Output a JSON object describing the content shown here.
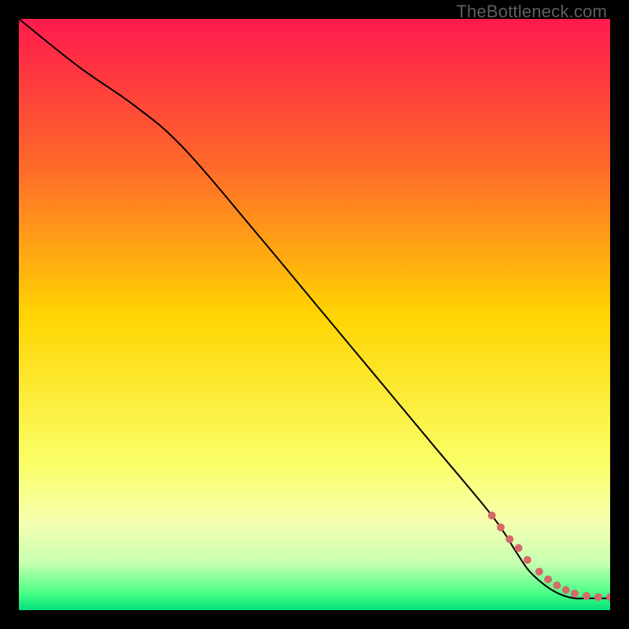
{
  "watermark": "TheBottleneck.com",
  "chart_data": {
    "type": "line",
    "title": "",
    "xlabel": "",
    "ylabel": "",
    "xlim": [
      0,
      100
    ],
    "ylim": [
      0,
      100
    ],
    "grid": false,
    "legend": "none",
    "gradient_stops": [
      {
        "offset": 0,
        "color": "#ff1a4d"
      },
      {
        "offset": 0.25,
        "color": "#ff6a2a"
      },
      {
        "offset": 0.5,
        "color": "#ffd400"
      },
      {
        "offset": 0.75,
        "color": "#faff66"
      },
      {
        "offset": 0.85,
        "color": "#f7ffb0"
      },
      {
        "offset": 0.92,
        "color": "#c8ffb0"
      },
      {
        "offset": 0.97,
        "color": "#4dff88"
      },
      {
        "offset": 1.0,
        "color": "#00e07a"
      }
    ],
    "series": [
      {
        "name": "bottleneck-curve",
        "color": "#000000",
        "stroke_width": 2,
        "x": [
          0,
          10,
          20,
          28,
          40,
          50,
          60,
          70,
          80,
          84,
          86,
          88,
          90,
          92,
          94,
          96,
          98,
          100
        ],
        "y": [
          100,
          92,
          85,
          78,
          64,
          52,
          40,
          28,
          16,
          10,
          7,
          5,
          3.5,
          2.5,
          2,
          2,
          2,
          2
        ]
      }
    ],
    "markers": {
      "name": "highlight-points",
      "color": "#d46a6a",
      "radius": 5,
      "x": [
        80,
        81.5,
        83,
        84.5,
        86,
        88,
        89.5,
        91,
        92.5,
        94,
        96,
        98,
        100
      ],
      "y": [
        16,
        14,
        12,
        10.5,
        8.5,
        6.5,
        5.2,
        4.2,
        3.4,
        2.8,
        2.4,
        2.2,
        2.2
      ]
    }
  }
}
